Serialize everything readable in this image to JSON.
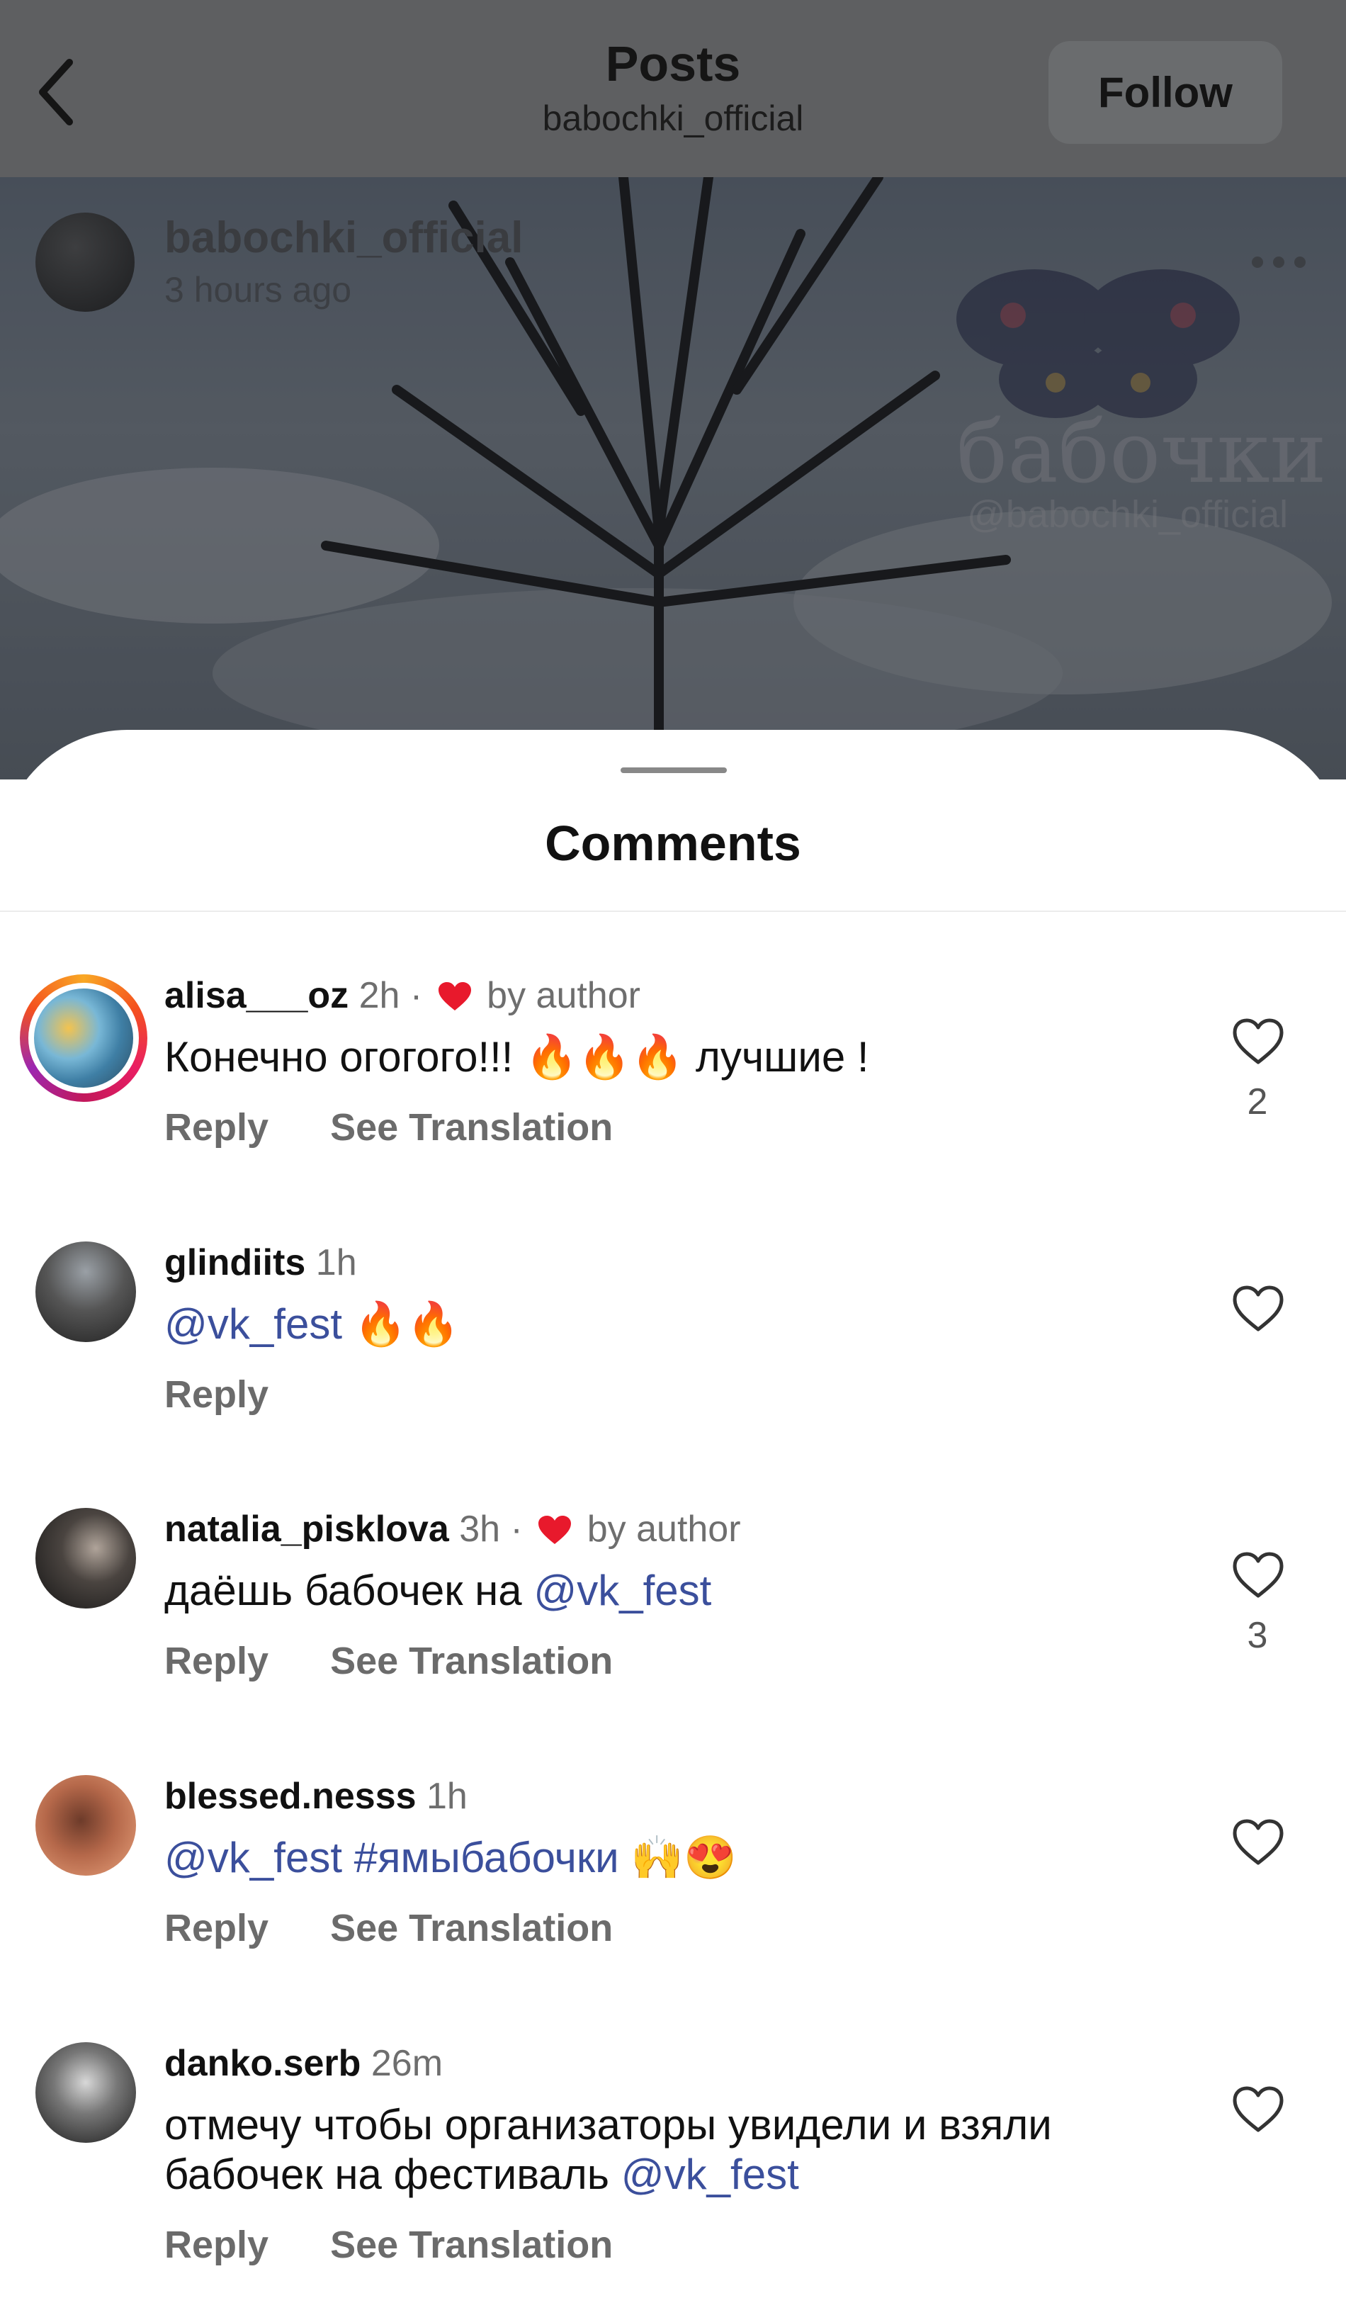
{
  "header": {
    "title": "Posts",
    "subtitle": "babochki_official",
    "follow_label": "Follow",
    "back_icon": "chevron-left-icon"
  },
  "post": {
    "author": "babochki_official",
    "time": "3 hours ago",
    "more_icon": "ellipsis-icon",
    "watermark": "бабочки",
    "watermark_handle": "@babochki_official"
  },
  "comments_sheet": {
    "title": "Comments",
    "comments": [
      {
        "username": "alisa___oz",
        "time": "2h ·",
        "liked_by_author": "by author",
        "text": "Конечно огогого!!! 🔥🔥🔥 лучшие !",
        "reply": "Reply",
        "translate": "See Translation",
        "likes": "2"
      },
      {
        "username": "glindiits",
        "time": "1h",
        "mention": "@vk_fest",
        "text": " 🔥🔥",
        "reply": "Reply",
        "likes": ""
      },
      {
        "username": "natalia_pisklova",
        "time": "3h ·",
        "liked_by_author": "by author",
        "text": "даёшь бабочек на ",
        "mention": "@vk_fest",
        "reply": "Reply",
        "translate": "See Translation",
        "likes": "3"
      },
      {
        "username": "blessed.nesss",
        "time": "1h",
        "mention": "@vk_fest #ямыбабочки",
        "text": " 🙌😍",
        "reply": "Reply",
        "translate": "See Translation",
        "likes": ""
      },
      {
        "username": "danko.serb",
        "time": "26m",
        "text_line1": "отмечу чтобы организаторы увидели и взяли",
        "text_line2": "бабочек на фестиваль ",
        "mention": "@vk_fest",
        "reply": "Reply",
        "translate": "See Translation",
        "likes": ""
      }
    ]
  },
  "colors": {
    "mention": "#3b4f9c",
    "heart": "#e8192c",
    "meta_text": "#6e6e6e"
  }
}
